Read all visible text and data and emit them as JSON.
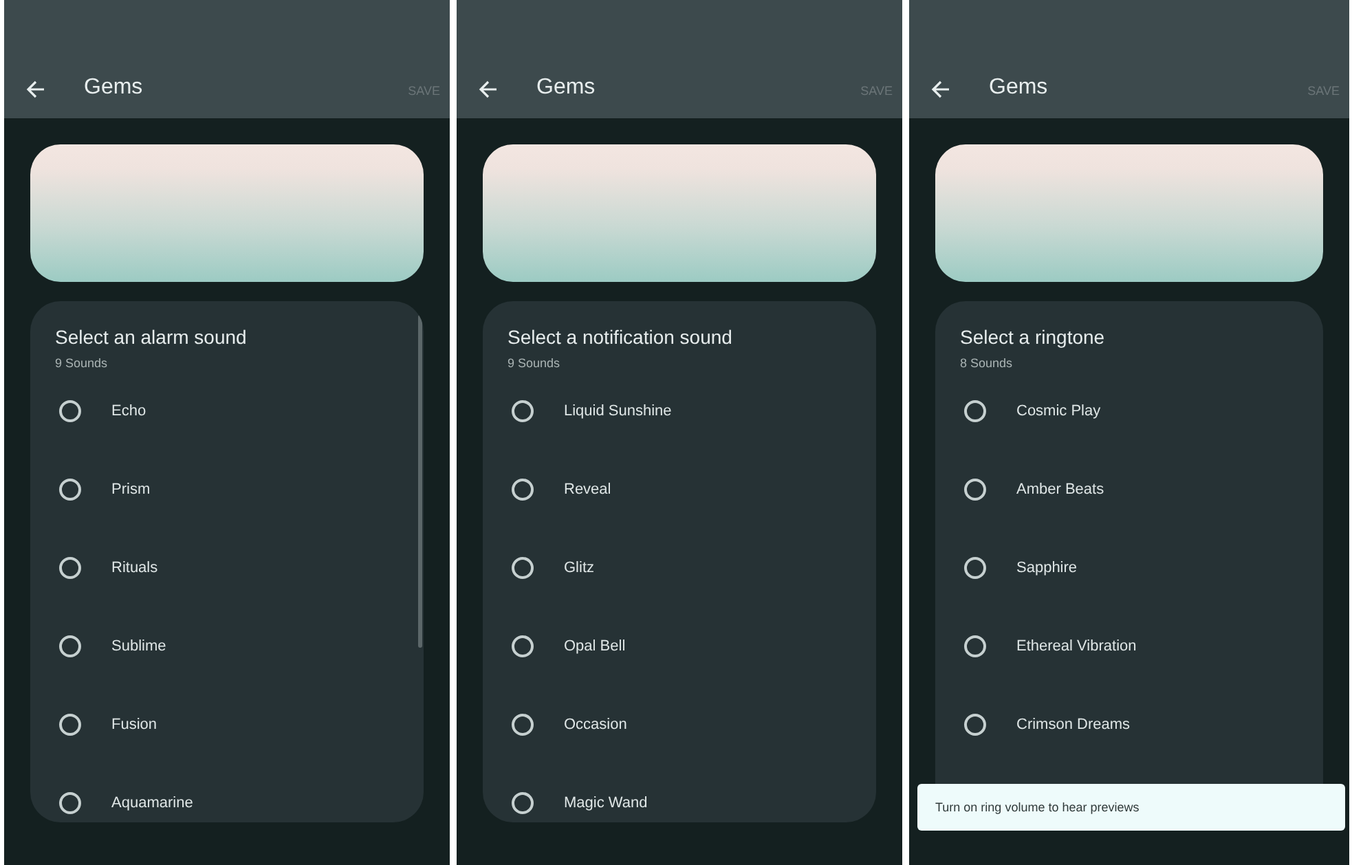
{
  "screens": [
    {
      "title": "Gems",
      "action": "SAVE",
      "heading": "Select an alarm sound",
      "count": "9 Sounds",
      "scrollbar": true,
      "options": [
        {
          "label": "Echo",
          "selected": false
        },
        {
          "label": "Prism",
          "selected": false
        },
        {
          "label": "Rituals",
          "selected": false
        },
        {
          "label": "Sublime",
          "selected": false
        },
        {
          "label": "Fusion",
          "selected": false
        },
        {
          "label": "Aquamarine",
          "selected": false
        }
      ]
    },
    {
      "title": "Gems",
      "action": "SAVE",
      "heading": "Select a notification sound",
      "count": "9 Sounds",
      "options": [
        {
          "label": "Liquid Sunshine",
          "selected": false
        },
        {
          "label": "Reveal",
          "selected": false
        },
        {
          "label": "Glitz",
          "selected": false
        },
        {
          "label": "Opal Bell",
          "selected": false
        },
        {
          "label": "Occasion",
          "selected": false
        },
        {
          "label": "Magic Wand",
          "selected": false
        }
      ]
    },
    {
      "title": "Gems",
      "action": "SAVE",
      "heading": "Select a ringtone",
      "count": "8 Sounds",
      "options": [
        {
          "label": "Cosmic Play",
          "selected": false
        },
        {
          "label": "Amber Beats",
          "selected": false
        },
        {
          "label": "Sapphire",
          "selected": false
        },
        {
          "label": "Ethereal Vibration",
          "selected": false
        },
        {
          "label": "Crimson Dreams",
          "selected": false
        }
      ],
      "snackbar": {
        "text": "Turn on ring volume to hear previews"
      }
    }
  ]
}
